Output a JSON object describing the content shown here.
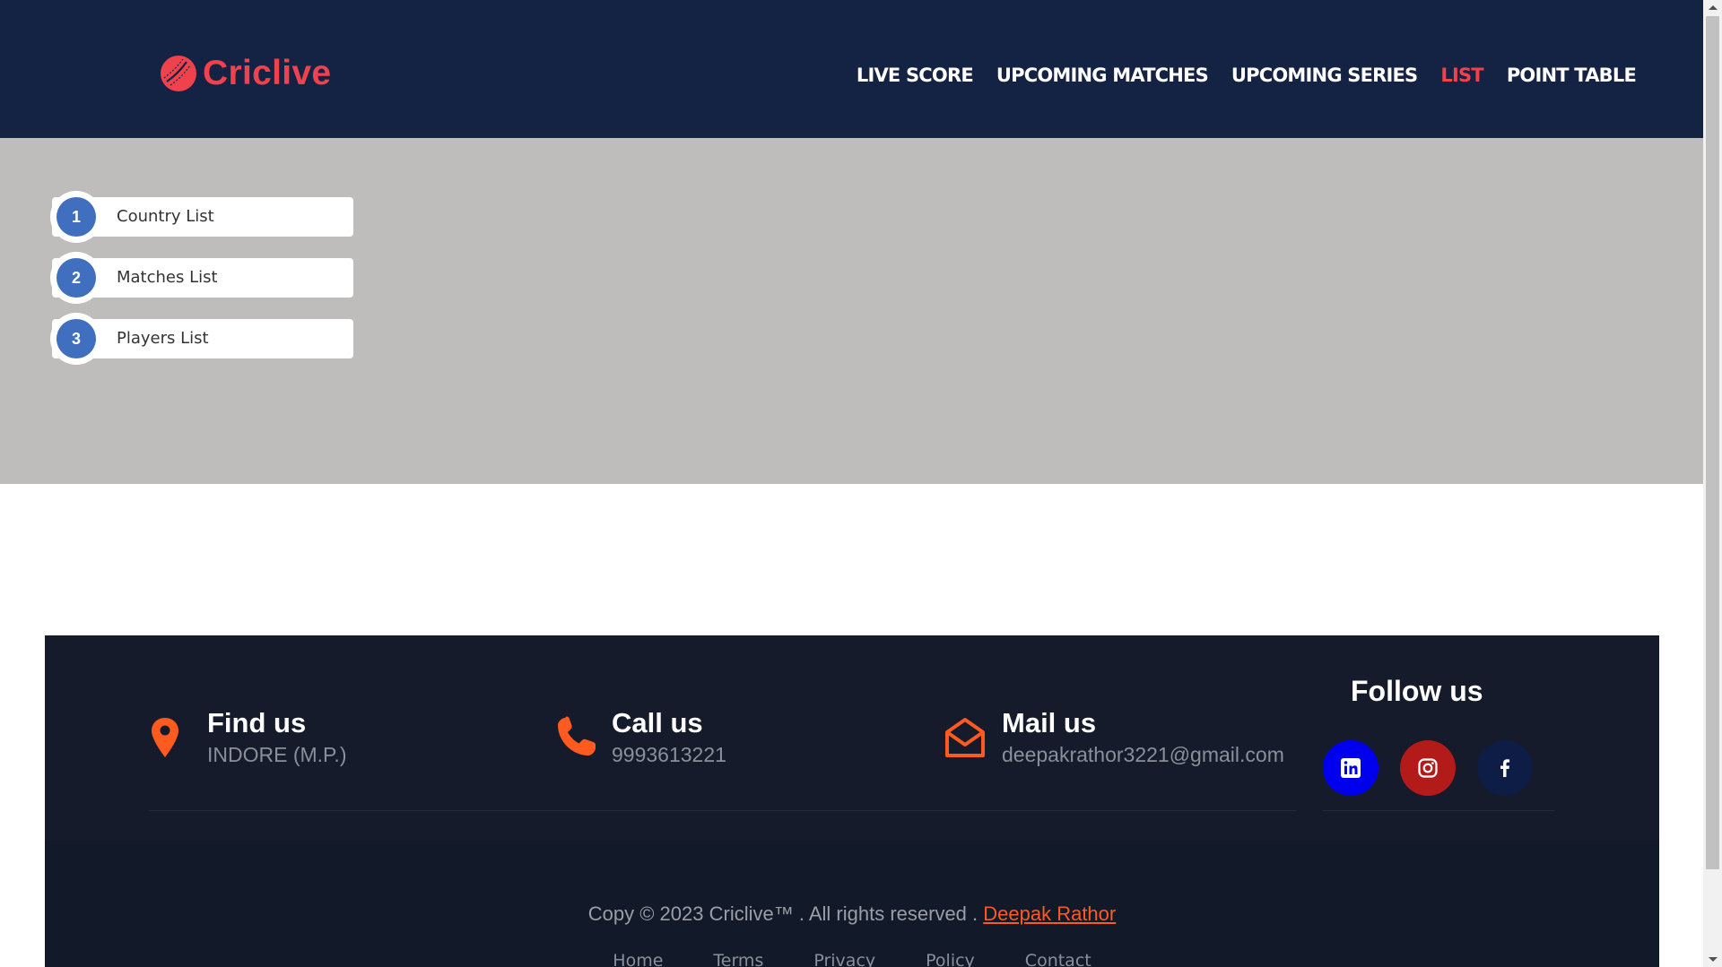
{
  "header": {
    "logo_text": "Criclive",
    "nav": [
      {
        "label": "LIVE SCORE",
        "active": false
      },
      {
        "label": "UPCOMING MATCHES",
        "active": false
      },
      {
        "label": "UPCOMING SERIES",
        "active": false
      },
      {
        "label": "LIST",
        "active": true
      },
      {
        "label": "POINT TABLE",
        "active": false
      }
    ]
  },
  "list": {
    "items": [
      {
        "number": "1",
        "label": "Country List"
      },
      {
        "number": "2",
        "label": "Matches List"
      },
      {
        "number": "3",
        "label": "Players List"
      }
    ]
  },
  "footer": {
    "find": {
      "title": "Find us",
      "value": "INDORE (M.P.)",
      "icon": "map-pin-icon"
    },
    "call": {
      "title": "Call us",
      "value": "9993613221",
      "icon": "phone-icon"
    },
    "mail": {
      "title": "Mail us",
      "value": "deepakrathor3221@gmail.com",
      "icon": "envelope-open-icon"
    },
    "follow_title": "Follow us",
    "social": [
      {
        "name": "linkedin-icon",
        "color": "#0000ee"
      },
      {
        "name": "instagram-icon",
        "color": "#b31b1b"
      },
      {
        "name": "facebook-icon",
        "color": "#0e1d45"
      }
    ],
    "copyright_text": "Copy © 2023 Criclive™ . All rights reserved . ",
    "author": "Deepak Rathor",
    "links": [
      "Home",
      "Terms",
      "Privacy",
      "Policy",
      "Contact"
    ]
  },
  "colors": {
    "header_bg": "#142243",
    "accent_red": "#f0424d",
    "accent_orange": "#ff5a1f",
    "list_bg": "#bebdbb",
    "badge_blue": "#3f6fbe",
    "footer_bg": "#151b2b"
  }
}
